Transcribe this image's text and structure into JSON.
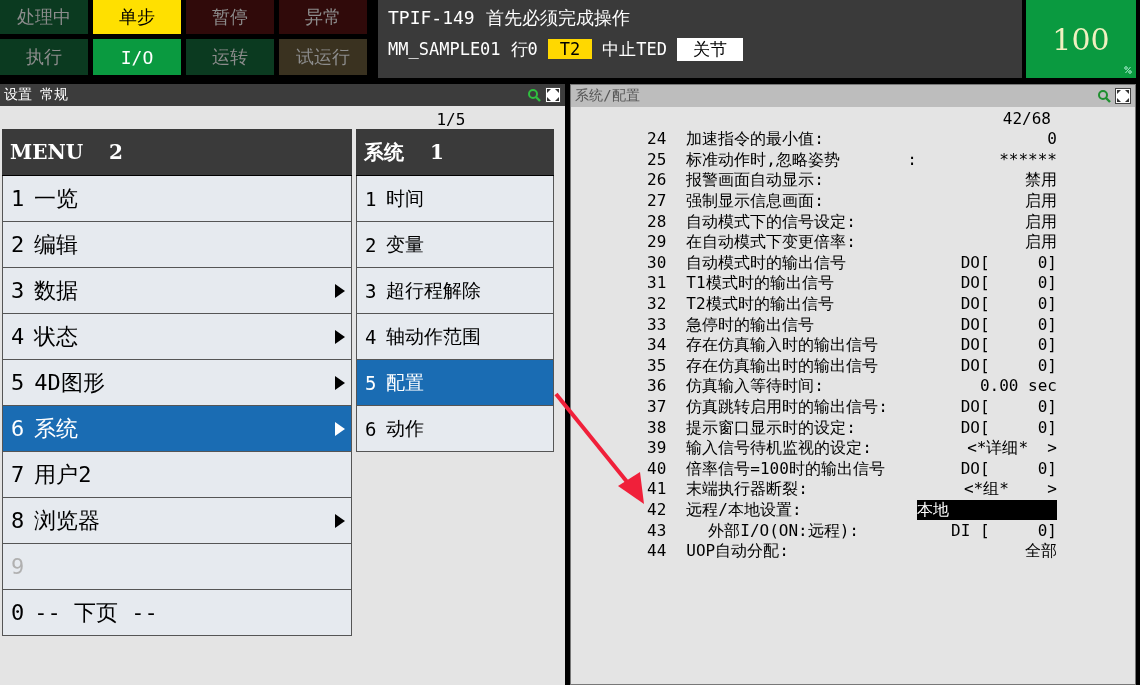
{
  "status_buttons": [
    {
      "label": "处理中",
      "color": "#0b3a20",
      "on": false
    },
    {
      "label": "单步",
      "color": "#ffe000",
      "on": true
    },
    {
      "label": "暂停",
      "color": "#300a0a",
      "on": false
    },
    {
      "label": "异常",
      "color": "#300a0a",
      "on": false
    },
    {
      "label": "执行",
      "color": "#0b3a20",
      "on": false
    },
    {
      "label": "I/O",
      "color": "#0a9a40",
      "on": true
    },
    {
      "label": "运转",
      "color": "#0b3a20",
      "on": false
    },
    {
      "label": "试运行",
      "color": "#3a3220",
      "on": false
    }
  ],
  "message": "TPIF-149 首先必须完成操作",
  "program": "MM_SAMPLE01",
  "line": "行0",
  "mode": "T2",
  "state": "中止TED",
  "coord": "关节",
  "override": "100",
  "left_pane": {
    "title": "设置 常规",
    "page": "1/5"
  },
  "menu": {
    "title": "MENU",
    "page": "2",
    "items": [
      {
        "number": "1",
        "label": "一览",
        "has_submenu": false,
        "selected": false,
        "disabled": false
      },
      {
        "number": "2",
        "label": "编辑",
        "has_submenu": false,
        "selected": false,
        "disabled": false
      },
      {
        "number": "3",
        "label": "数据",
        "has_submenu": true,
        "selected": false,
        "disabled": false
      },
      {
        "number": "4",
        "label": "状态",
        "has_submenu": true,
        "selected": false,
        "disabled": false
      },
      {
        "number": "5",
        "label": "4D图形",
        "has_submenu": true,
        "selected": false,
        "disabled": false
      },
      {
        "number": "6",
        "label": "系统",
        "has_submenu": true,
        "selected": true,
        "disabled": false
      },
      {
        "number": "7",
        "label": "用户2",
        "has_submenu": false,
        "selected": false,
        "disabled": false
      },
      {
        "number": "8",
        "label": "浏览器",
        "has_submenu": true,
        "selected": false,
        "disabled": false
      },
      {
        "number": "9",
        "has_submenu": false,
        "selected": false,
        "disabled": true
      },
      {
        "number": "0",
        "label": "-- 下页 --",
        "has_submenu": false,
        "selected": false,
        "disabled": false
      }
    ]
  },
  "submenu": {
    "title": "系统",
    "page": "1",
    "items": [
      {
        "number": "1",
        "label": "时间",
        "selected": false
      },
      {
        "number": "2",
        "label": "变量",
        "selected": false
      },
      {
        "number": "3",
        "label": "超行程解除",
        "selected": false
      },
      {
        "number": "4",
        "label": "轴动作范围",
        "selected": false
      },
      {
        "number": "5",
        "label": "配置",
        "selected": true
      },
      {
        "number": "6",
        "label": "动作",
        "selected": false
      }
    ]
  },
  "right_pane": {
    "title": "系统/配置",
    "page": "42/68",
    "items": [
      {
        "number": "24",
        "label": "加速指令的最小值:",
        "value": "0",
        "kind": "item",
        "selected": false
      },
      {
        "number": "25",
        "label": "标准动作时,忽略姿势       :",
        "value": "******",
        "kind": "item",
        "selected": false
      },
      {
        "number": "26",
        "label": "报警画面自动显示:",
        "value": "禁用",
        "kind": "item",
        "selected": false
      },
      {
        "number": "27",
        "label": "强制显示信息画面:",
        "value": "启用",
        "kind": "item",
        "selected": false
      },
      {
        "number": "28",
        "label": "自动模式下的信号设定:",
        "value": "启用",
        "kind": "item",
        "selected": false
      },
      {
        "number": "29",
        "label": "在自动模式下变更倍率:",
        "value": "启用",
        "kind": "item",
        "selected": false
      },
      {
        "number": "30",
        "label": "自动模式时的输出信号",
        "value": "DO[     0]",
        "kind": "item",
        "selected": false
      },
      {
        "number": "31",
        "label": "T1模式时的输出信号",
        "value": "DO[     0]",
        "kind": "item",
        "selected": false
      },
      {
        "number": "32",
        "label": "T2模式时的输出信号",
        "value": "DO[     0]",
        "kind": "item",
        "selected": false
      },
      {
        "number": "33",
        "label": "急停时的输出信号",
        "value": "DO[     0]",
        "kind": "item",
        "selected": false
      },
      {
        "number": "34",
        "label": "存在仿真输入时的输出信号",
        "value": "DO[     0]",
        "kind": "item",
        "selected": false
      },
      {
        "number": "35",
        "label": "存在仿真输出时的输出信号",
        "value": "DO[     0]",
        "kind": "item",
        "selected": false
      },
      {
        "number": "36",
        "label": "仿真输入等待时间:",
        "value": "0.00 sec",
        "kind": "item",
        "selected": false
      },
      {
        "number": "37",
        "label": "仿真跳转启用时的输出信号:",
        "value": "DO[     0]",
        "kind": "item",
        "selected": false
      },
      {
        "number": "38",
        "label": "提示窗口显示时的设定:",
        "value": "DO[     0]",
        "kind": "item",
        "selected": false
      },
      {
        "number": "39",
        "label": "输入信号待机监视的设定:",
        "value": "<*详细*  >",
        "kind": "item",
        "selected": false
      },
      {
        "number": "40",
        "label": "倍率信号=100时的输出信号",
        "value": "DO[     0]",
        "kind": "item",
        "selected": false
      },
      {
        "number": "41",
        "label": "末端执行器断裂:",
        "value": "<*组*    >",
        "kind": "item",
        "selected": false
      },
      {
        "number": "42",
        "label": "远程/本地设置:",
        "value": "本地",
        "kind": "item",
        "selected": true
      },
      {
        "number": "43",
        "label": "外部I/O(ON:远程):",
        "value": "DI [     0]",
        "kind": "sub",
        "selected": false
      },
      {
        "number": "44",
        "label": "UOP自动分配:",
        "value": "全部",
        "kind": "item",
        "selected": false
      }
    ]
  }
}
